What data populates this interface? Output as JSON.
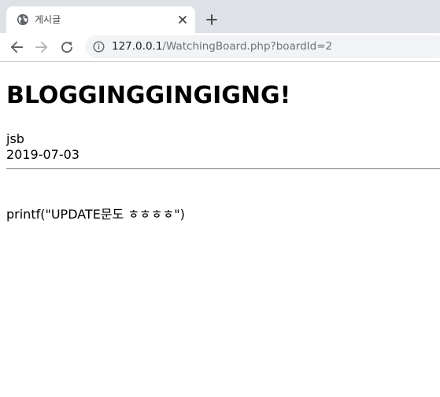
{
  "browser": {
    "tab": {
      "title": "게시글",
      "favicon": "globe-icon",
      "close_icon": "close-icon"
    },
    "new_tab_icon": "plus-icon",
    "toolbar": {
      "back_icon": "back-arrow-icon",
      "forward_icon": "forward-arrow-icon",
      "reload_icon": "reload-icon",
      "site_info_icon": "info-icon"
    },
    "address": {
      "host": "127.0.0.1",
      "path": "/WatchingBoard.php?boardId=2"
    }
  },
  "post": {
    "title": "BLOGGINGGINGIGNG!",
    "author": "jsb",
    "date": "2019-07-03",
    "body": "printf(\"UPDATE문도 ㅎㅎㅎㅎ\")"
  },
  "colors": {
    "chrome_bg": "#dee1e6",
    "omnibox_bg": "#f1f3f4",
    "url_path": "#6f7276",
    "divider": "#9a9a9a"
  }
}
